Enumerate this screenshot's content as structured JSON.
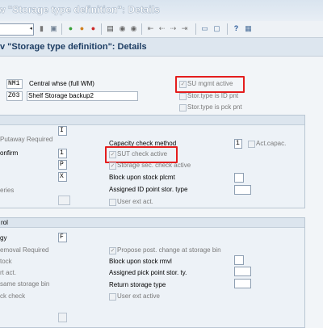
{
  "window": {
    "title": "w \"Storage type definition\": Details"
  },
  "header": {
    "title": "v \"Storage type definition\": Details"
  },
  "top": {
    "warehouse_value": "NM1",
    "warehouse_desc": "Central whse (full WM)",
    "stortype_value": "Z03",
    "stortype_desc": "Shelf Storage backup2",
    "su_mgmt_label": "SU mgmt active",
    "su_mgmt_checked": true,
    "id_pnt_label": "Stor.type is ID pnt",
    "pick_pnt_label": "Stor.type is pck pnt"
  },
  "putaway": {
    "lbl_required": "Putaway Required",
    "val_required": "I",
    "lbl_confirm": "onfirm",
    "val_confirm": "1",
    "val_row3": "P",
    "val_row4": "X",
    "lbl_row5": "eries",
    "capacity_label": "Capacity check method",
    "capacity_value": "1",
    "act_capac_label": "Act.capac.",
    "sut_label": "SUT check active",
    "sut_checked": true,
    "storage_sec_label": "Storage sec. check active",
    "storage_sec_checked": true,
    "block_label": "Block upon stock plcmt",
    "assigned_id_label": "Assigned ID point stor. type",
    "user_ext_label": "User ext act."
  },
  "removal": {
    "title": "rol",
    "lbl_strategy": "gy",
    "val_strategy": "F",
    "lbl_required": "emoval Required",
    "lbl_stock": "tock",
    "lbl_act": "rt act.",
    "lbl_same": "same storage bin",
    "lbl_check": "ck check",
    "propose_label": "Propose post. change at storage bin",
    "propose_checked": true,
    "block_label": "Block upon stock rmvl",
    "assigned_pick_label": "Assigned pick point stor. ty.",
    "return_label": "Return storage type",
    "user_ext_label": "User ext active"
  },
  "toolbar": {
    "icons": [
      "check-icon",
      "save-icon",
      "back-icon",
      "exit-icon",
      "cancel-icon",
      "print-icon",
      "find-icon",
      "find-next-icon",
      "first-page-icon",
      "prev-page-icon",
      "next-page-icon",
      "last-page-icon",
      "new-session-icon",
      "shortcut-icon",
      "help-icon",
      "layout-icon"
    ]
  }
}
